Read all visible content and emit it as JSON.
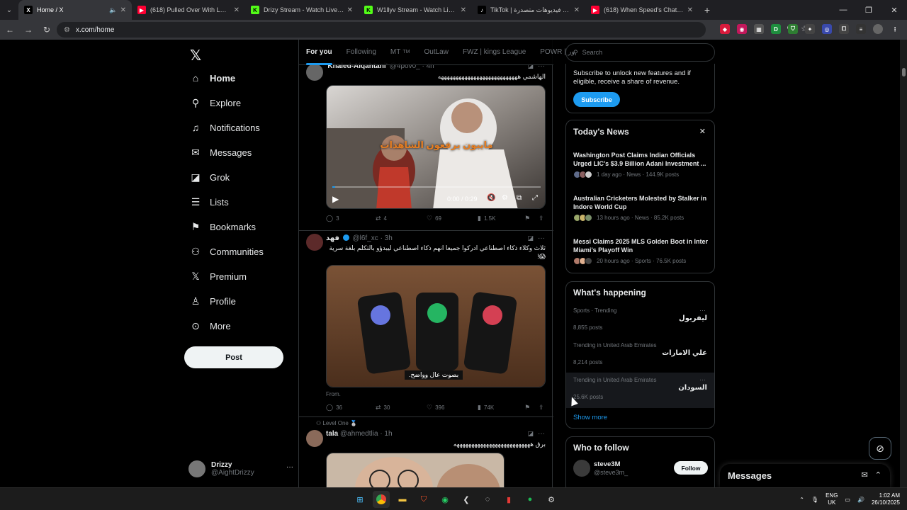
{
  "browser": {
    "tabs": [
      {
        "label": "Home / X",
        "icon": "x-logo-icon",
        "active": true,
        "muted": true
      },
      {
        "label": "(618) Pulled Over With LOTS Of",
        "icon": "youtube-icon"
      },
      {
        "label": "Drizy Stream - Watch Live on Ki",
        "icon": "kick-icon"
      },
      {
        "label": "W1llyv Stream - Watch Live on",
        "icon": "kick-icon"
      },
      {
        "label": "TikTok | شاهد فيديوهات متصدرة",
        "icon": "tiktok-icon"
      },
      {
        "label": "(618) When Speed's Chat Made",
        "icon": "youtube-icon"
      }
    ],
    "url": "x.com/home"
  },
  "nav": {
    "items": [
      {
        "label": "Home",
        "icon": "home-icon",
        "glyph": "⌂"
      },
      {
        "label": "Explore",
        "icon": "search-icon",
        "glyph": "⚲"
      },
      {
        "label": "Notifications",
        "icon": "bell-icon",
        "glyph": "🔔"
      },
      {
        "label": "Messages",
        "icon": "mail-icon",
        "glyph": "✉"
      },
      {
        "label": "Grok",
        "icon": "grok-icon",
        "glyph": "◪"
      },
      {
        "label": "Lists",
        "icon": "list-icon",
        "glyph": "☰"
      },
      {
        "label": "Bookmarks",
        "icon": "bookmark-icon",
        "glyph": "⚑"
      },
      {
        "label": "Communities",
        "icon": "people-icon",
        "glyph": "👥"
      },
      {
        "label": "Premium",
        "icon": "x-premium-icon",
        "glyph": "X"
      },
      {
        "label": "Profile",
        "icon": "person-icon",
        "glyph": "👤"
      },
      {
        "label": "More",
        "icon": "more-circle-icon",
        "glyph": "⋯"
      }
    ],
    "post_label": "Post",
    "account": {
      "name": "Drizzy",
      "handle": "@AightDrizzy"
    }
  },
  "feed": {
    "tabs": [
      {
        "label": "For you",
        "active": true
      },
      {
        "label": "Following"
      },
      {
        "label": "MT",
        "badge": "TM"
      },
      {
        "label": "OutLaw"
      },
      {
        "label": "FWZ | kings League"
      },
      {
        "label": "POWR | ور"
      }
    ],
    "tweets": [
      {
        "name": "'Khaled-Alqahtani'",
        "handle": "@4pov0_",
        "time": "4h",
        "text": "الهاشمي هههههههههههههههههههههههههههه",
        "video_caption": "مايبون يرفعون الشاهدات",
        "video_time": "0:00 / 0:29",
        "replies": "3",
        "reposts": "4",
        "likes": "69",
        "views": "1.5K"
      },
      {
        "name": "فهد",
        "handle": "@l6f_xc",
        "time": "3h",
        "text": "ثلاث وكلاء ذكاء اصطناعي ادركوا جميعا انهم ذكاء اصطناعي ليبدؤو بالتكلم بلغة سرية 😱!",
        "image_caption": "بصوت عال وواضح.",
        "from": "From.",
        "replies": "36",
        "reposts": "30",
        "likes": "396",
        "views": "74K"
      },
      {
        "context": "Level One 🥈",
        "name": "tala",
        "handle": "@ahmedtlia",
        "time": "1h",
        "text": "برق ههههههههههههههههههههههههههه"
      }
    ]
  },
  "sidebar": {
    "search_placeholder": "Search",
    "subscribe": {
      "text": "Subscribe to unlock new features and if eligible, receive a share of revenue.",
      "button": "Subscribe"
    },
    "news": {
      "title": "Today's News",
      "items": [
        {
          "title": "Washington Post Claims Indian Officials Urged LIC's $3.9 Billion Adani Investment ...",
          "meta": "1 day ago · News · 144.9K posts"
        },
        {
          "title": "Australian Cricketers Molested by Stalker in Indore World Cup",
          "meta": "13 hours ago · News · 85.2K posts"
        },
        {
          "title": "Messi Claims 2025 MLS Golden Boot in Inter Miami's Playoff Win",
          "meta": "20 hours ago · Sports · 76.5K posts"
        }
      ]
    },
    "happening": {
      "title": "What's happening",
      "trends": [
        {
          "category": "Sports · Trending",
          "name": "ليفربول",
          "posts": "8,855 posts"
        },
        {
          "category": "Trending in United Arab Emirates",
          "name": "علي الامارات",
          "posts": "8,214 posts"
        },
        {
          "category": "Trending in United Arab Emirates",
          "name": "السودان",
          "posts": "25.6K posts"
        }
      ],
      "show_more": "Show more"
    },
    "who_to_follow": {
      "title": "Who to follow",
      "name": "steve3M",
      "handle": "@steve3m_",
      "button": "Follow"
    }
  },
  "messages_drawer": {
    "title": "Messages"
  },
  "taskbar": {
    "lang_line1": "ENG",
    "lang_line2": "UK",
    "time": "1:02 AM",
    "date": "26/10/2025"
  },
  "colors": {
    "accent": "#1d9bf0",
    "background": "#000000",
    "border": "#2f3336",
    "muted": "#71767b"
  }
}
